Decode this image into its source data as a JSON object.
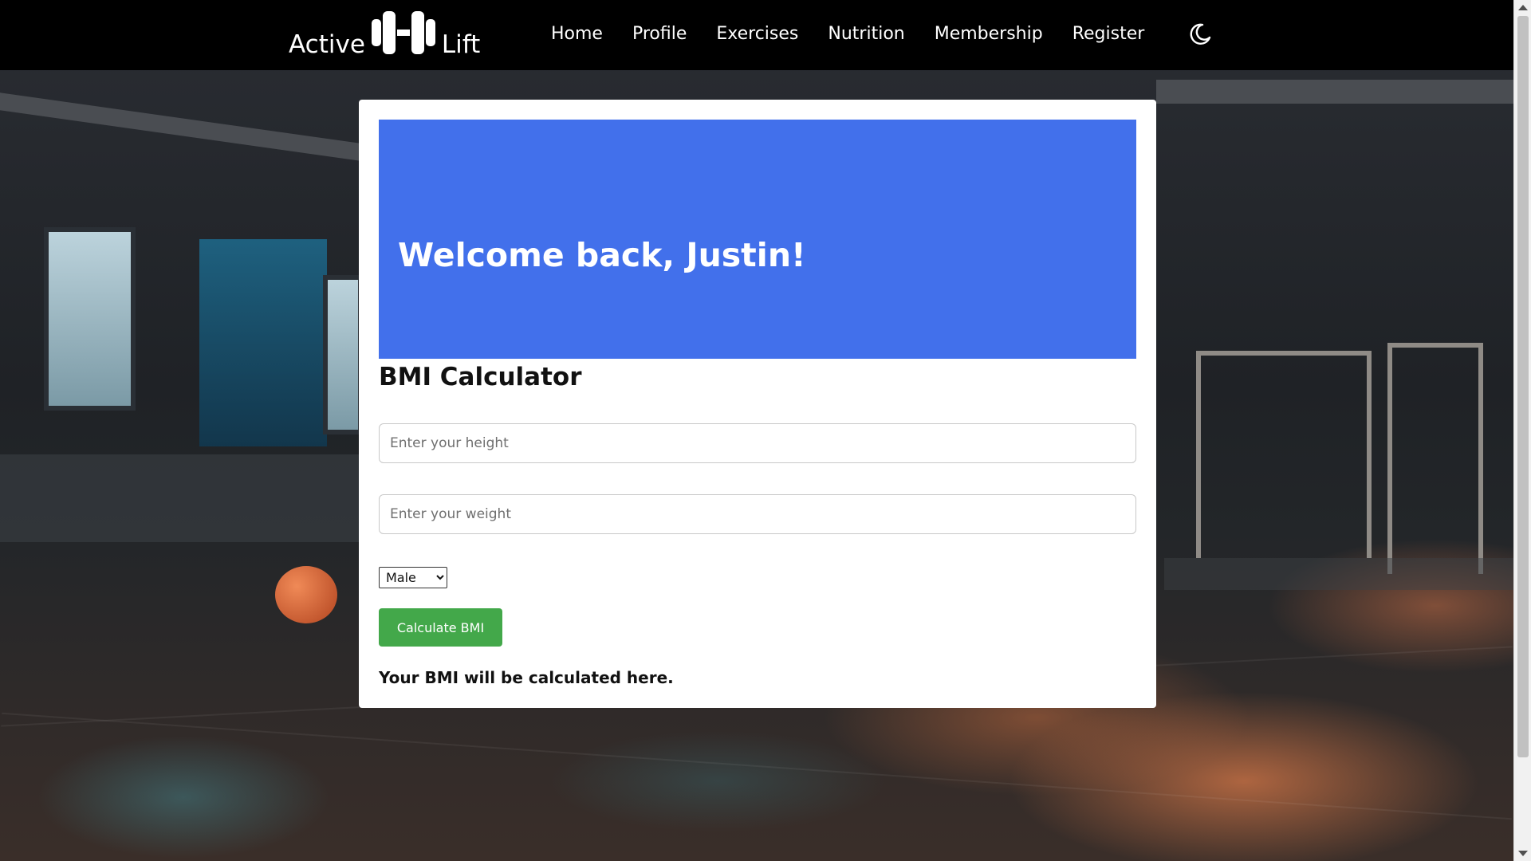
{
  "brand": {
    "word_left": "Active",
    "word_right": "Lift",
    "logo_icon": "dumbbell-icon"
  },
  "nav": {
    "items": [
      {
        "label": "Home"
      },
      {
        "label": "Profile"
      },
      {
        "label": "Exercises"
      },
      {
        "label": "Nutrition"
      },
      {
        "label": "Membership"
      },
      {
        "label": "Register"
      }
    ],
    "theme_toggle_icon": "moon-icon"
  },
  "welcome": {
    "heading": "Welcome back, Justin!",
    "banner_color": "#4270eb"
  },
  "bmi": {
    "title": "BMI Calculator",
    "height_placeholder": "Enter your height",
    "weight_placeholder": "Enter your weight",
    "gender_selected": "Male",
    "button_label": "Calculate BMI",
    "button_color": "#43a84a",
    "result_text": "Your BMI will be calculated here."
  }
}
